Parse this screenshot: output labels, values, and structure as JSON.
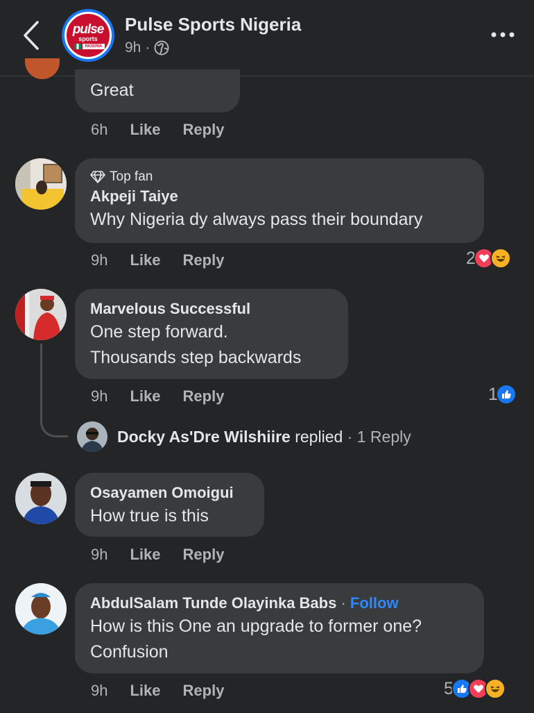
{
  "header": {
    "page_name": "Pulse Sports Nigeria",
    "post_time": "9h",
    "separator": "·",
    "logo": {
      "line1": "pulse",
      "line2": "sports",
      "line3": "NIGERIA"
    }
  },
  "comments": [
    {
      "author": "",
      "text": [
        "Great"
      ],
      "time": "6h",
      "like_label": "Like",
      "reply_label": "Reply"
    },
    {
      "badge": "Top fan",
      "author": "Akpeji Taiye",
      "text": [
        "Why Nigeria dy always pass their boundary"
      ],
      "time": "9h",
      "like_label": "Like",
      "reply_label": "Reply",
      "reaction_count": "2",
      "reactions": [
        "love-icon",
        "haha-icon"
      ]
    },
    {
      "author": "Marvelous Successful",
      "text": [
        "One step forward.",
        "Thousands step backwards"
      ],
      "time": "9h",
      "like_label": "Like",
      "reply_label": "Reply",
      "reaction_count": "1",
      "reactions": [
        "like-icon"
      ],
      "reply_summary": {
        "name": "Docky As'Dre Wilshiire",
        "verb": "replied",
        "separator": "·",
        "count": "1 Reply"
      }
    },
    {
      "author": "Osayamen Omoigui",
      "text": [
        "How true is this"
      ],
      "time": "9h",
      "like_label": "Like",
      "reply_label": "Reply"
    },
    {
      "author": "AbdulSalam Tunde Olayinka Babs",
      "separator": "·",
      "follow_label": "Follow",
      "text": [
        "How is this One an upgrade to former one?",
        "Confusion"
      ],
      "time": "9h",
      "like_label": "Like",
      "reply_label": "Reply",
      "reaction_count": "5",
      "reactions": [
        "like-icon",
        "love-icon",
        "haha-icon"
      ]
    }
  ],
  "colors": {
    "background": "#242526",
    "bubble": "#3a3b3c",
    "secondary_text": "#b0b3b8",
    "link": "#2d88ff",
    "like": "#1877f2",
    "love": "#f33e58",
    "haha": "#f7b125"
  }
}
